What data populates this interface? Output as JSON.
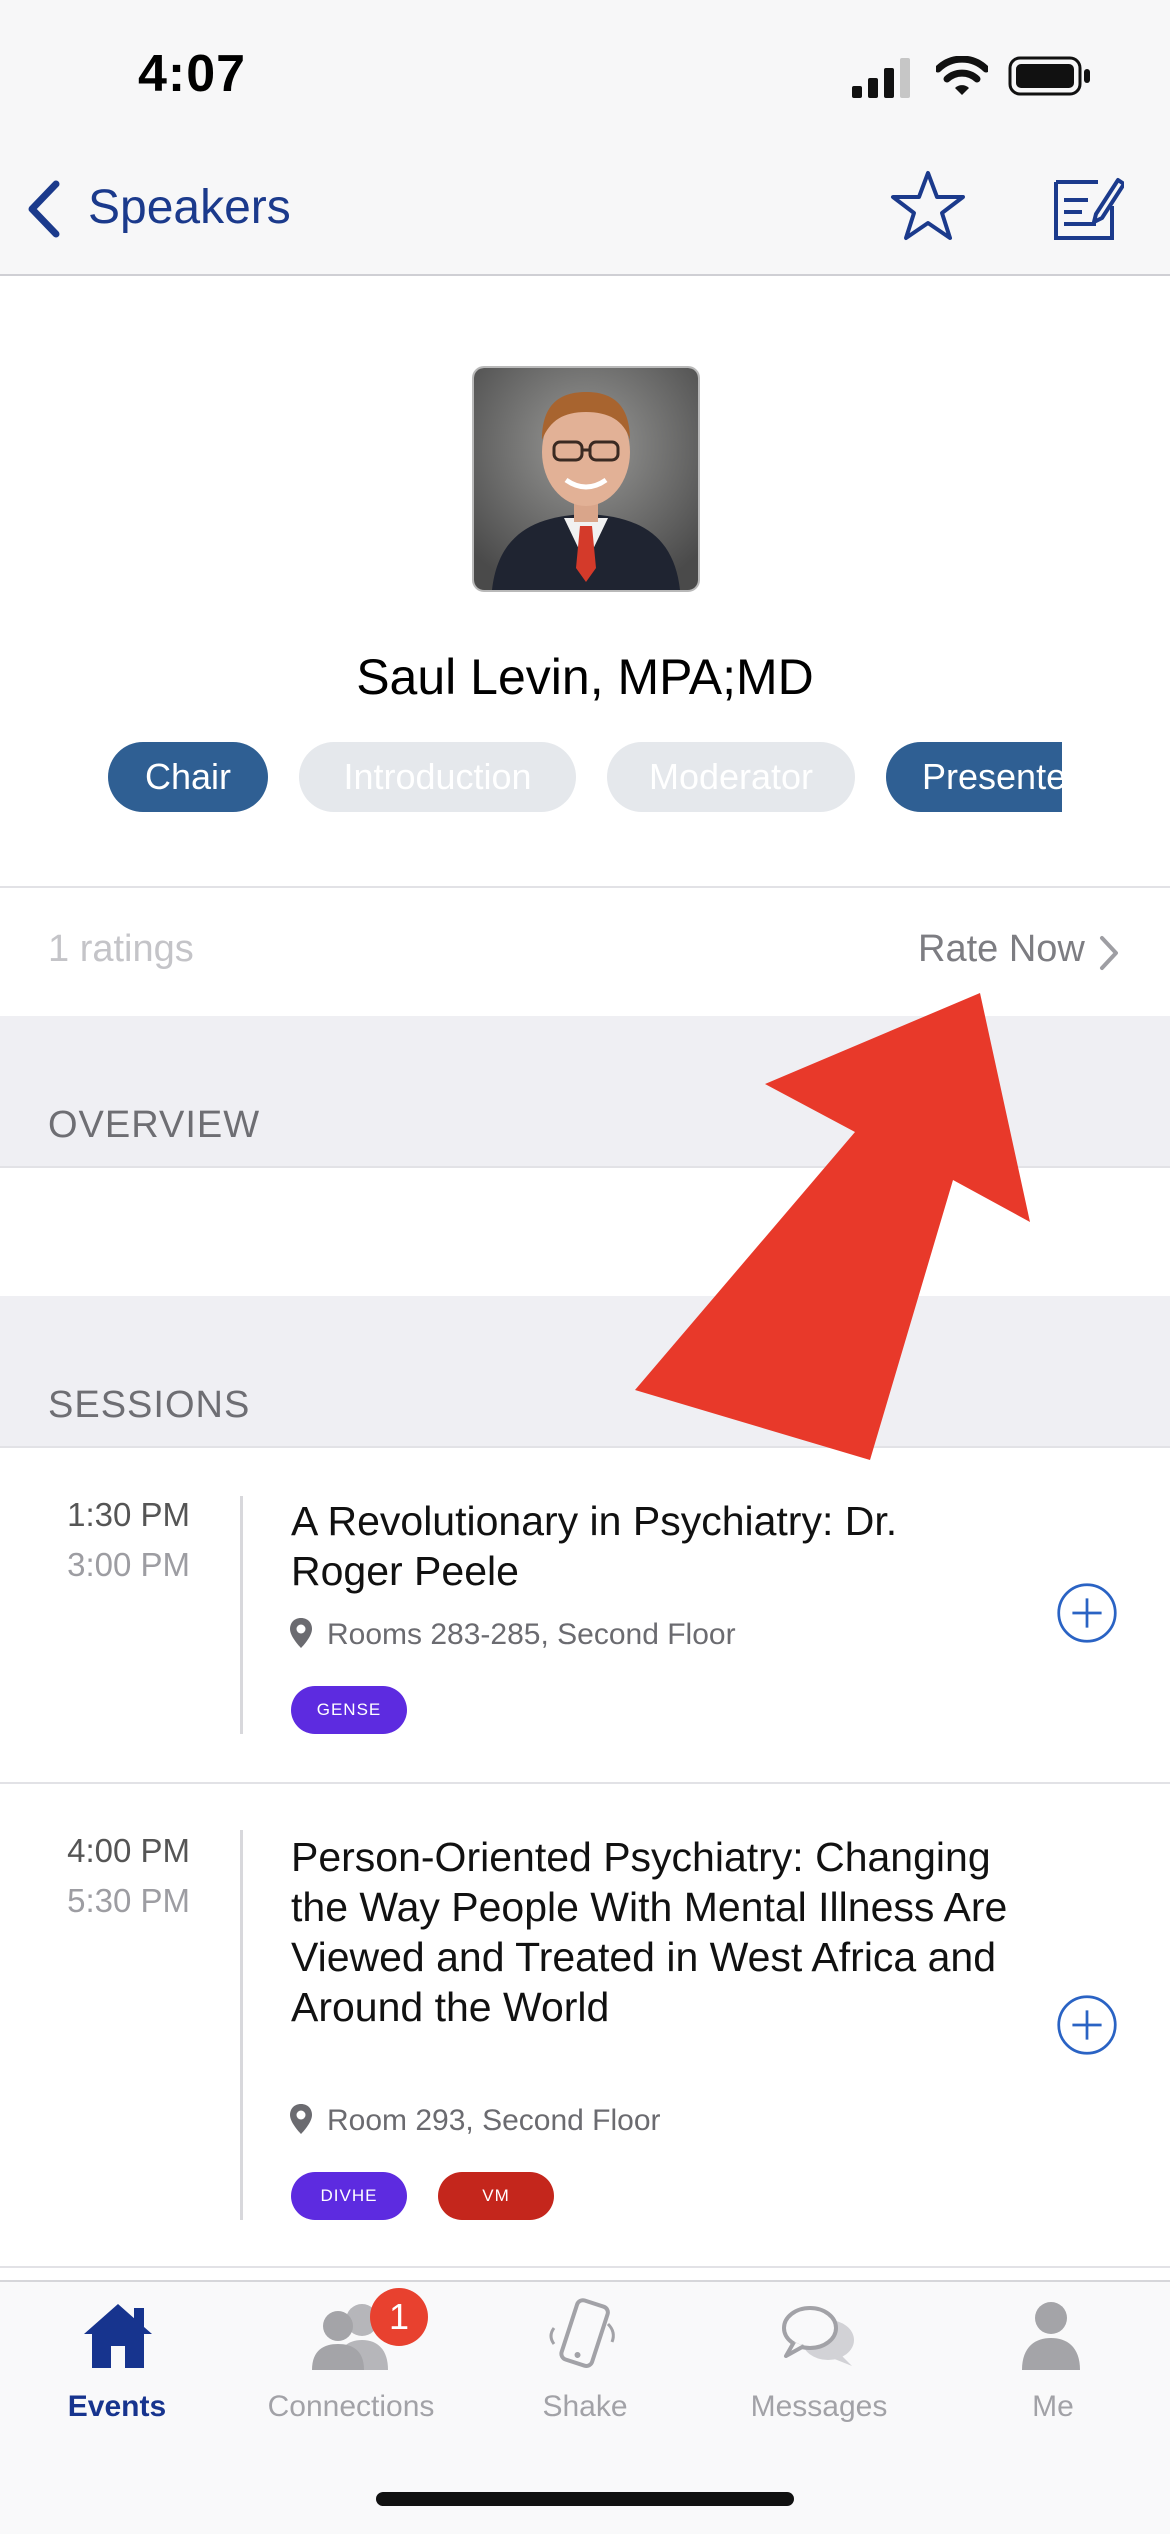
{
  "status_bar": {
    "time": "4:07"
  },
  "nav": {
    "back_label": "Speakers"
  },
  "speaker": {
    "name": "Saul Levin, MPA;MD",
    "roles": [
      {
        "label": "Chair",
        "active": true
      },
      {
        "label": "Introduction",
        "active": false
      },
      {
        "label": "Moderator",
        "active": false
      },
      {
        "label": "Presente",
        "active": true
      }
    ]
  },
  "rating": {
    "count_label": "1 ratings",
    "rate_now": "Rate Now"
  },
  "overview": {
    "title": "OVERVIEW"
  },
  "sessions": {
    "title": "SESSIONS",
    "items": [
      {
        "start": "1:30 PM",
        "end": "3:00 PM",
        "title": "A Revolutionary in Psychiatry: Dr. Roger Peele",
        "room": "Rooms 283-285, Second Floor",
        "tags": [
          {
            "label": "GENSE",
            "color": "#5d2be0"
          }
        ]
      },
      {
        "start": "4:00 PM",
        "end": "5:30 PM",
        "title": "Person-Oriented Psychiatry: Changing the Way People With Mental Illness Are Viewed and Treated in West Africa and Around the World",
        "room": "Room 293, Second Floor",
        "tags": [
          {
            "label": "DIVHE",
            "color": "#5d2be0"
          },
          {
            "label": "VM",
            "color": "#c4261c"
          }
        ]
      }
    ]
  },
  "tab_bar": {
    "tabs": [
      {
        "label": "Events",
        "icon": "home-icon",
        "active": true
      },
      {
        "label": "Connections",
        "icon": "people-icon",
        "badge": "1"
      },
      {
        "label": "Shake",
        "icon": "shake-phone-icon"
      },
      {
        "label": "Messages",
        "icon": "chat-bubbles-icon"
      },
      {
        "label": "Me",
        "icon": "person-icon"
      }
    ]
  },
  "colors": {
    "accent": "#1b3a8c",
    "pill_active": "#2f5f93",
    "annotation_arrow": "#e8392a"
  }
}
